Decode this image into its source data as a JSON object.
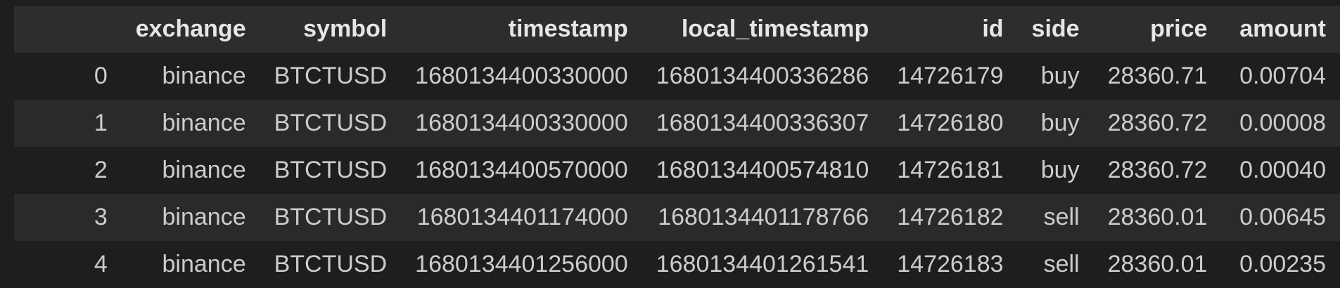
{
  "table": {
    "columns": [
      "",
      "exchange",
      "symbol",
      "timestamp",
      "local_timestamp",
      "id",
      "side",
      "price",
      "amount"
    ],
    "rows": [
      {
        "index": "0",
        "exchange": "binance",
        "symbol": "BTCTUSD",
        "timestamp": "1680134400330000",
        "local_timestamp": "1680134400336286",
        "id": "14726179",
        "side": "buy",
        "price": "28360.71",
        "amount": "0.00704"
      },
      {
        "index": "1",
        "exchange": "binance",
        "symbol": "BTCTUSD",
        "timestamp": "1680134400330000",
        "local_timestamp": "1680134400336307",
        "id": "14726180",
        "side": "buy",
        "price": "28360.72",
        "amount": "0.00008"
      },
      {
        "index": "2",
        "exchange": "binance",
        "symbol": "BTCTUSD",
        "timestamp": "1680134400570000",
        "local_timestamp": "1680134400574810",
        "id": "14726181",
        "side": "buy",
        "price": "28360.72",
        "amount": "0.00040"
      },
      {
        "index": "3",
        "exchange": "binance",
        "symbol": "BTCTUSD",
        "timestamp": "1680134401174000",
        "local_timestamp": "1680134401178766",
        "id": "14726182",
        "side": "sell",
        "price": "28360.01",
        "amount": "0.00645"
      },
      {
        "index": "4",
        "exchange": "binance",
        "symbol": "BTCTUSD",
        "timestamp": "1680134401256000",
        "local_timestamp": "1680134401261541",
        "id": "14726183",
        "side": "sell",
        "price": "28360.01",
        "amount": "0.00235"
      }
    ]
  },
  "colors": {
    "background": "#1e1e1e",
    "header_background": "#2d2d2d",
    "striped_row": "#2a2a2a",
    "text": "#cccccc"
  }
}
